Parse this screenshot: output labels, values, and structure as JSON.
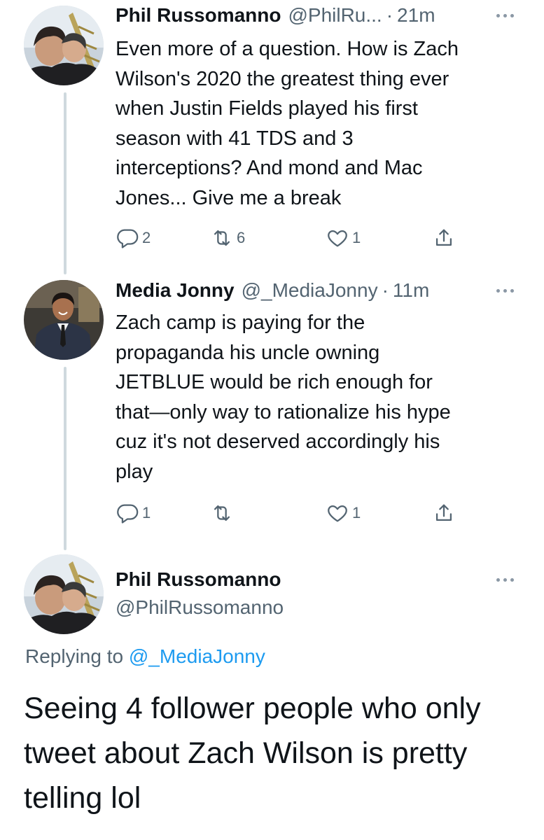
{
  "colors": {
    "text": "#0f1419",
    "muted": "#536471",
    "link": "#1d9bf0",
    "thread_line": "#cfd9de"
  },
  "tweets": [
    {
      "avatar": "phil-avatar-photo",
      "name": "Phil Russomanno",
      "handle": "@PhilRu...",
      "separator": "·",
      "time": "21m",
      "text": "Even more of a question. How is Zach\nWilson's 2020 the greatest thing ever\nwhen Justin Fields played his first\nseason with 41 TDS and 3\ninterceptions? And mond and Mac\nJones... Give me a break",
      "replies": "2",
      "retweets": "6",
      "likes": "1"
    },
    {
      "avatar": "media-jonny-avatar-photo",
      "name": "Media Jonny",
      "handle": "@_MediaJonny",
      "separator": "·",
      "time": "11m",
      "text": "Zach camp is paying for the\npropaganda his uncle owning\nJETBLUE would be rich enough for\nthat—only way to rationalize his hype\ncuz it's not deserved accordingly his\nplay",
      "replies": "1",
      "retweets": "",
      "likes": "1"
    }
  ],
  "main_tweet": {
    "avatar": "phil-avatar-photo",
    "name": "Phil Russomanno",
    "handle": "@PhilRussomanno",
    "replying_prefix": "Replying to",
    "replying_to": "@_MediaJonny",
    "text": "Seeing 4 follower people who only\ntweet about Zach Wilson is pretty\ntelling lol"
  },
  "icons": [
    "more-icon",
    "reply-icon",
    "retweet-icon",
    "like-icon",
    "share-icon"
  ]
}
